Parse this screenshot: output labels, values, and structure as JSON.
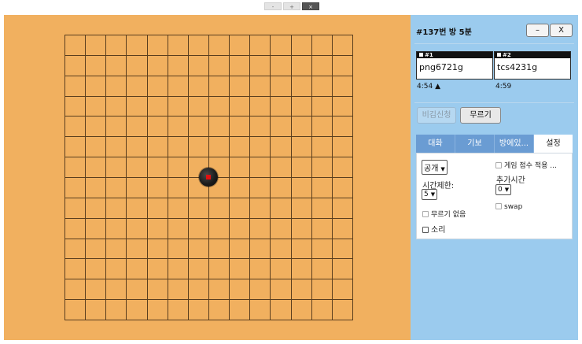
{
  "toolbar": {
    "btn1": "-",
    "btn2": "+",
    "btn3": "×"
  },
  "room": {
    "title": "#137번 방 5분",
    "minimize_label": "–",
    "close_label": "X"
  },
  "players": [
    {
      "tag": "#1",
      "name": "png6721g",
      "time": "4:54 ▲"
    },
    {
      "tag": "#2",
      "name": "tcs4231g",
      "time": "4:59"
    }
  ],
  "actions": {
    "draw_label": "비김신청",
    "undo_label": "무르기"
  },
  "tabs": [
    {
      "label": "대화"
    },
    {
      "label": "기보"
    },
    {
      "label": "방에있..."
    },
    {
      "label": "설정"
    }
  ],
  "settings": {
    "visibility": "공개",
    "time_limit_label": "시간제한:",
    "time_limit_value": "5",
    "no_undo_label": "무르기 없음",
    "sound_label": "소리",
    "apply_score_label": "게임 점수 적용 ...",
    "extra_time_label": "추가시간",
    "extra_time_value": "0",
    "swap_label": "swap"
  },
  "colors": {
    "board": "#f1b05f",
    "panel": "#9bcbee",
    "tab": "#6a9cd3",
    "last_move_marker": "#e01010"
  }
}
